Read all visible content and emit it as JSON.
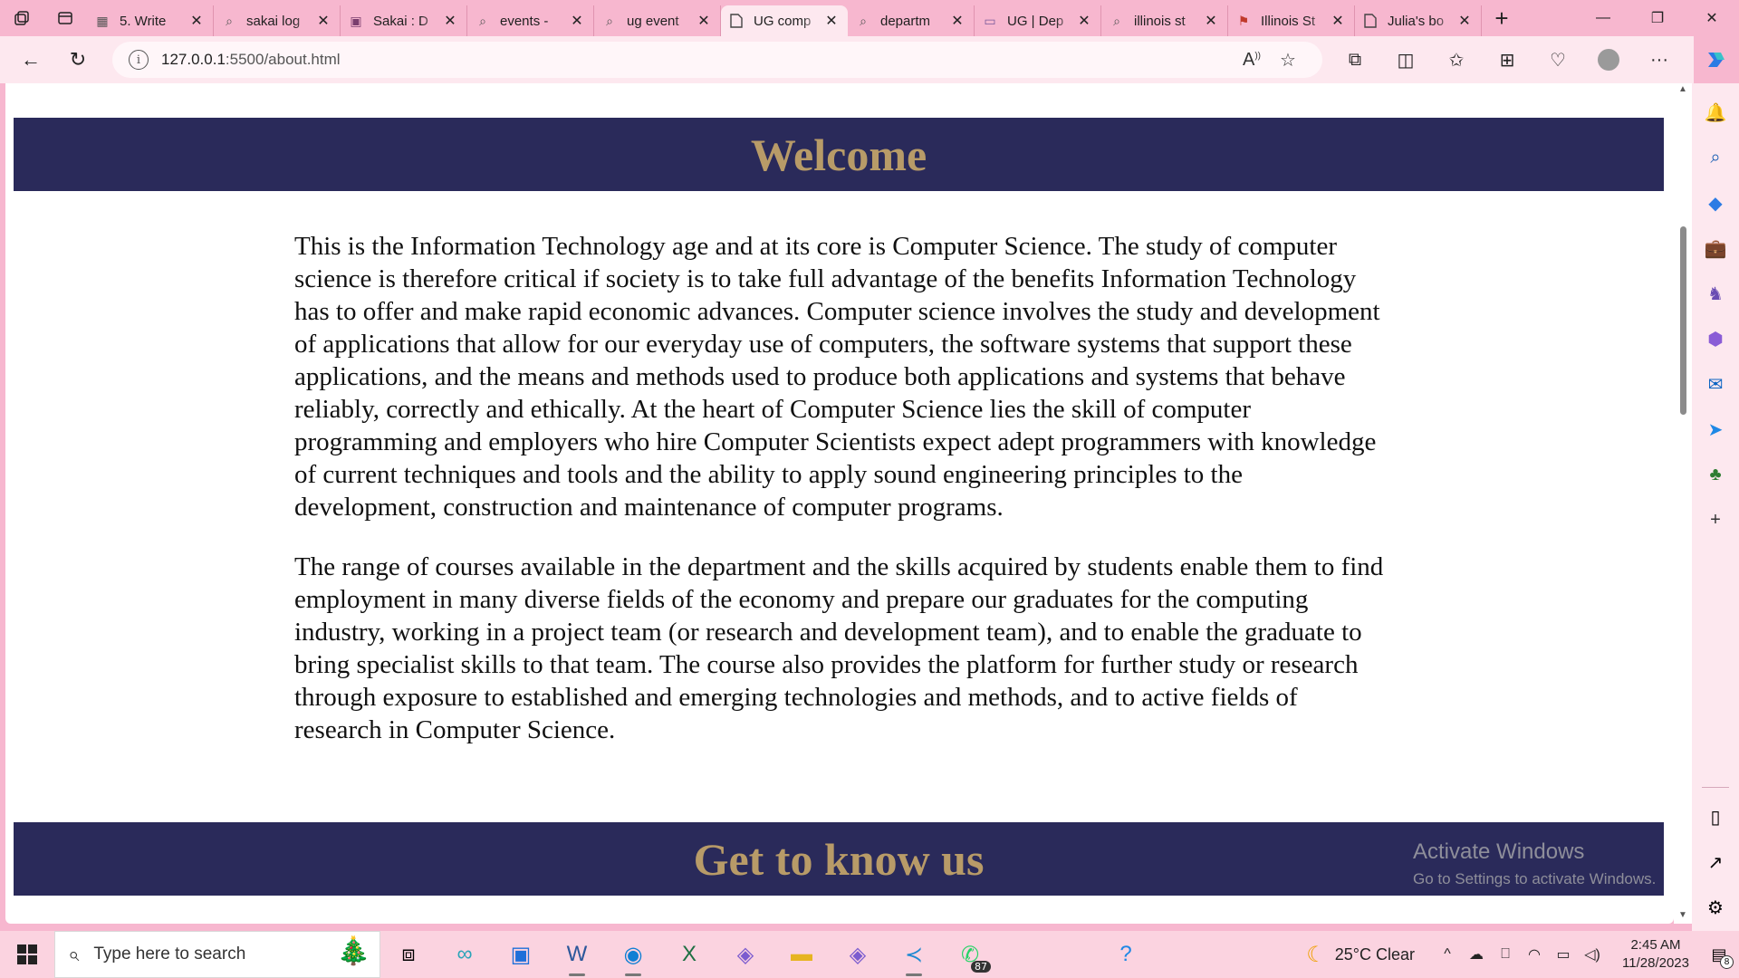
{
  "browser": {
    "tabs": [
      {
        "title": "5. Write",
        "icon": "grid-favicon"
      },
      {
        "title": "sakai log",
        "icon": "search-favicon"
      },
      {
        "title": "Sakai : D",
        "icon": "sakai-favicon"
      },
      {
        "title": "events -",
        "icon": "search-favicon"
      },
      {
        "title": "ug event",
        "icon": "search-favicon"
      },
      {
        "title": "UG comp",
        "icon": "page-favicon",
        "active": true
      },
      {
        "title": "departm",
        "icon": "search-favicon"
      },
      {
        "title": "UG | Dep",
        "icon": "ug-favicon"
      },
      {
        "title": "illinois st",
        "icon": "search-favicon"
      },
      {
        "title": "Illinois St",
        "icon": "illinois-favicon"
      },
      {
        "title": "Julia's bo",
        "icon": "page-favicon"
      }
    ],
    "address": {
      "host": "127.0.0.1",
      "path": ":5500/about.html"
    }
  },
  "page": {
    "welcome_heading": "Welcome",
    "paragraph_1": "This is the Information Technology age and at its core is Computer Science. The study of computer science is therefore critical if society is to take full advantage of the benefits Information Technology has to offer and make rapid economic advances. Computer science involves the study and development of applications that allow for our everyday use of computers, the software systems that support these applications, and the means and methods used to produce both applications and systems that behave reliably, correctly and ethically. At the heart of Computer Science lies the skill of computer programming and employers who hire Computer Scientists expect adept programmers with knowledge of current techniques and tools and the ability to apply sound engineering principles to the development, construction and maintenance of computer programs.",
    "paragraph_2": "The range of courses available in the department and the skills acquired by students enable them to find employment in many diverse fields of the economy and prepare our graduates for the computing industry, working in a project team (or research and development team), and to enable the graduate to bring specialist skills to that team. The course also provides the platform for further study or research through exposure to established and emerging technologies and methods, and to active fields of research in Computer Science.",
    "get_to_know_heading": "Get to know us",
    "banner_color": "#2a2a5a",
    "heading_color": "#b89b68"
  },
  "watermark": {
    "line1": "Activate Windows",
    "line2": "Go to Settings to activate Windows."
  },
  "taskbar": {
    "search_placeholder": "Type here to search",
    "whatsapp_badge": "87",
    "weather": "25°C  Clear",
    "time": "2:45 AM",
    "date": "11/28/2023",
    "notification_count": "8"
  }
}
